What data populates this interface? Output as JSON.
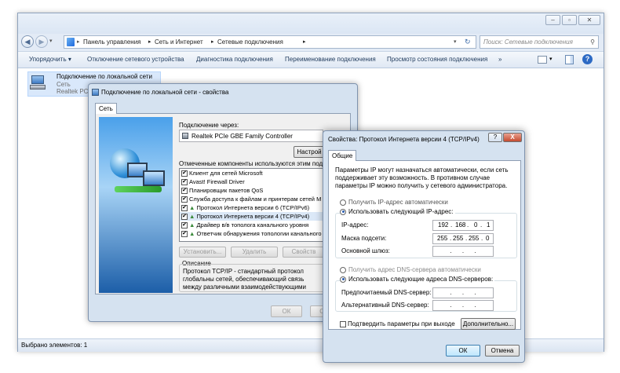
{
  "explorer": {
    "address": {
      "crumbs": [
        "Панель управления",
        "Сеть и Интернет",
        "Сетевые подключения"
      ],
      "search_placeholder": "Поиск: Сетевые подключения"
    },
    "toolbar": {
      "organize": "Упорядочить ▾",
      "disable": "Отключение сетевого устройства",
      "diagnose": "Диагностика подключения",
      "rename": "Переименование подключения",
      "status": "Просмотр состояния подключения",
      "more": "»"
    },
    "connection": {
      "name": "Подключение по локальной сети",
      "network": "Сеть",
      "adapter": "Realtek PCIe"
    },
    "status_bar": "Выбрано элементов: 1"
  },
  "props": {
    "title": "Подключение по локальной сети - свойства",
    "tab": "Сеть",
    "connect_using_label": "Подключение через:",
    "adapter": "Realtek PCIe GBE Family Controller",
    "configure_button": "Настрой",
    "components_label": "Отмеченные компоненты используются этим подключен",
    "components": [
      "Клиент для сетей Microsoft",
      "Avast! Firewall Driver",
      "Планировщик пакетов QoS",
      "Служба доступа к файлам и принтерам сетей М",
      "Протокол Интернета версии 6 (TCP/IPv6)",
      "Протокол Интернета версии 4 (TCP/IPv4)",
      "Драйвер в/в тополога канального уровня",
      "Ответчик обнаружения топологии канального у"
    ],
    "install_button": "Установить...",
    "remove_button": "Удалить",
    "properties_button": "Свойств",
    "description_label": "Описание",
    "description": "Протокол TCP/IP - стандартный протокол глобальны сетей, обеспечивающий связь между различными взаимодействующими сетями.",
    "ok": "ОК",
    "cancel": "Отм"
  },
  "ipv4": {
    "title": "Свойства: Протокол Интернета версии 4 (TCP/IPv4)",
    "tab": "Общие",
    "intro": "Параметры IP могут назначаться автоматически, если сеть поддерживает эту возможность. В противном случае параметры IP можно получить у сетевого администратора.",
    "auto_ip": "Получить IP-адрес автоматически",
    "manual_ip": "Использовать следующий IP-адрес:",
    "ip_label": "IP-адрес:",
    "ip_value": [
      "192",
      "168",
      "0",
      "1"
    ],
    "mask_label": "Маска подсети:",
    "mask_value": [
      "255",
      "255",
      "255",
      "0"
    ],
    "gateway_label": "Основной шлюз:",
    "auto_dns": "Получить адрес DNS-сервера автоматически",
    "manual_dns": "Использовать следующие адреса DNS-серверов:",
    "pref_dns_label": "Предпочитаемый DNS-сервер:",
    "alt_dns_label": "Альтернативный DNS-сервер:",
    "validate": "Подтвердить параметры при выходе",
    "advanced": "Дополнительно...",
    "ok": "ОК",
    "cancel": "Отмена",
    "help": "?",
    "close": "X"
  }
}
